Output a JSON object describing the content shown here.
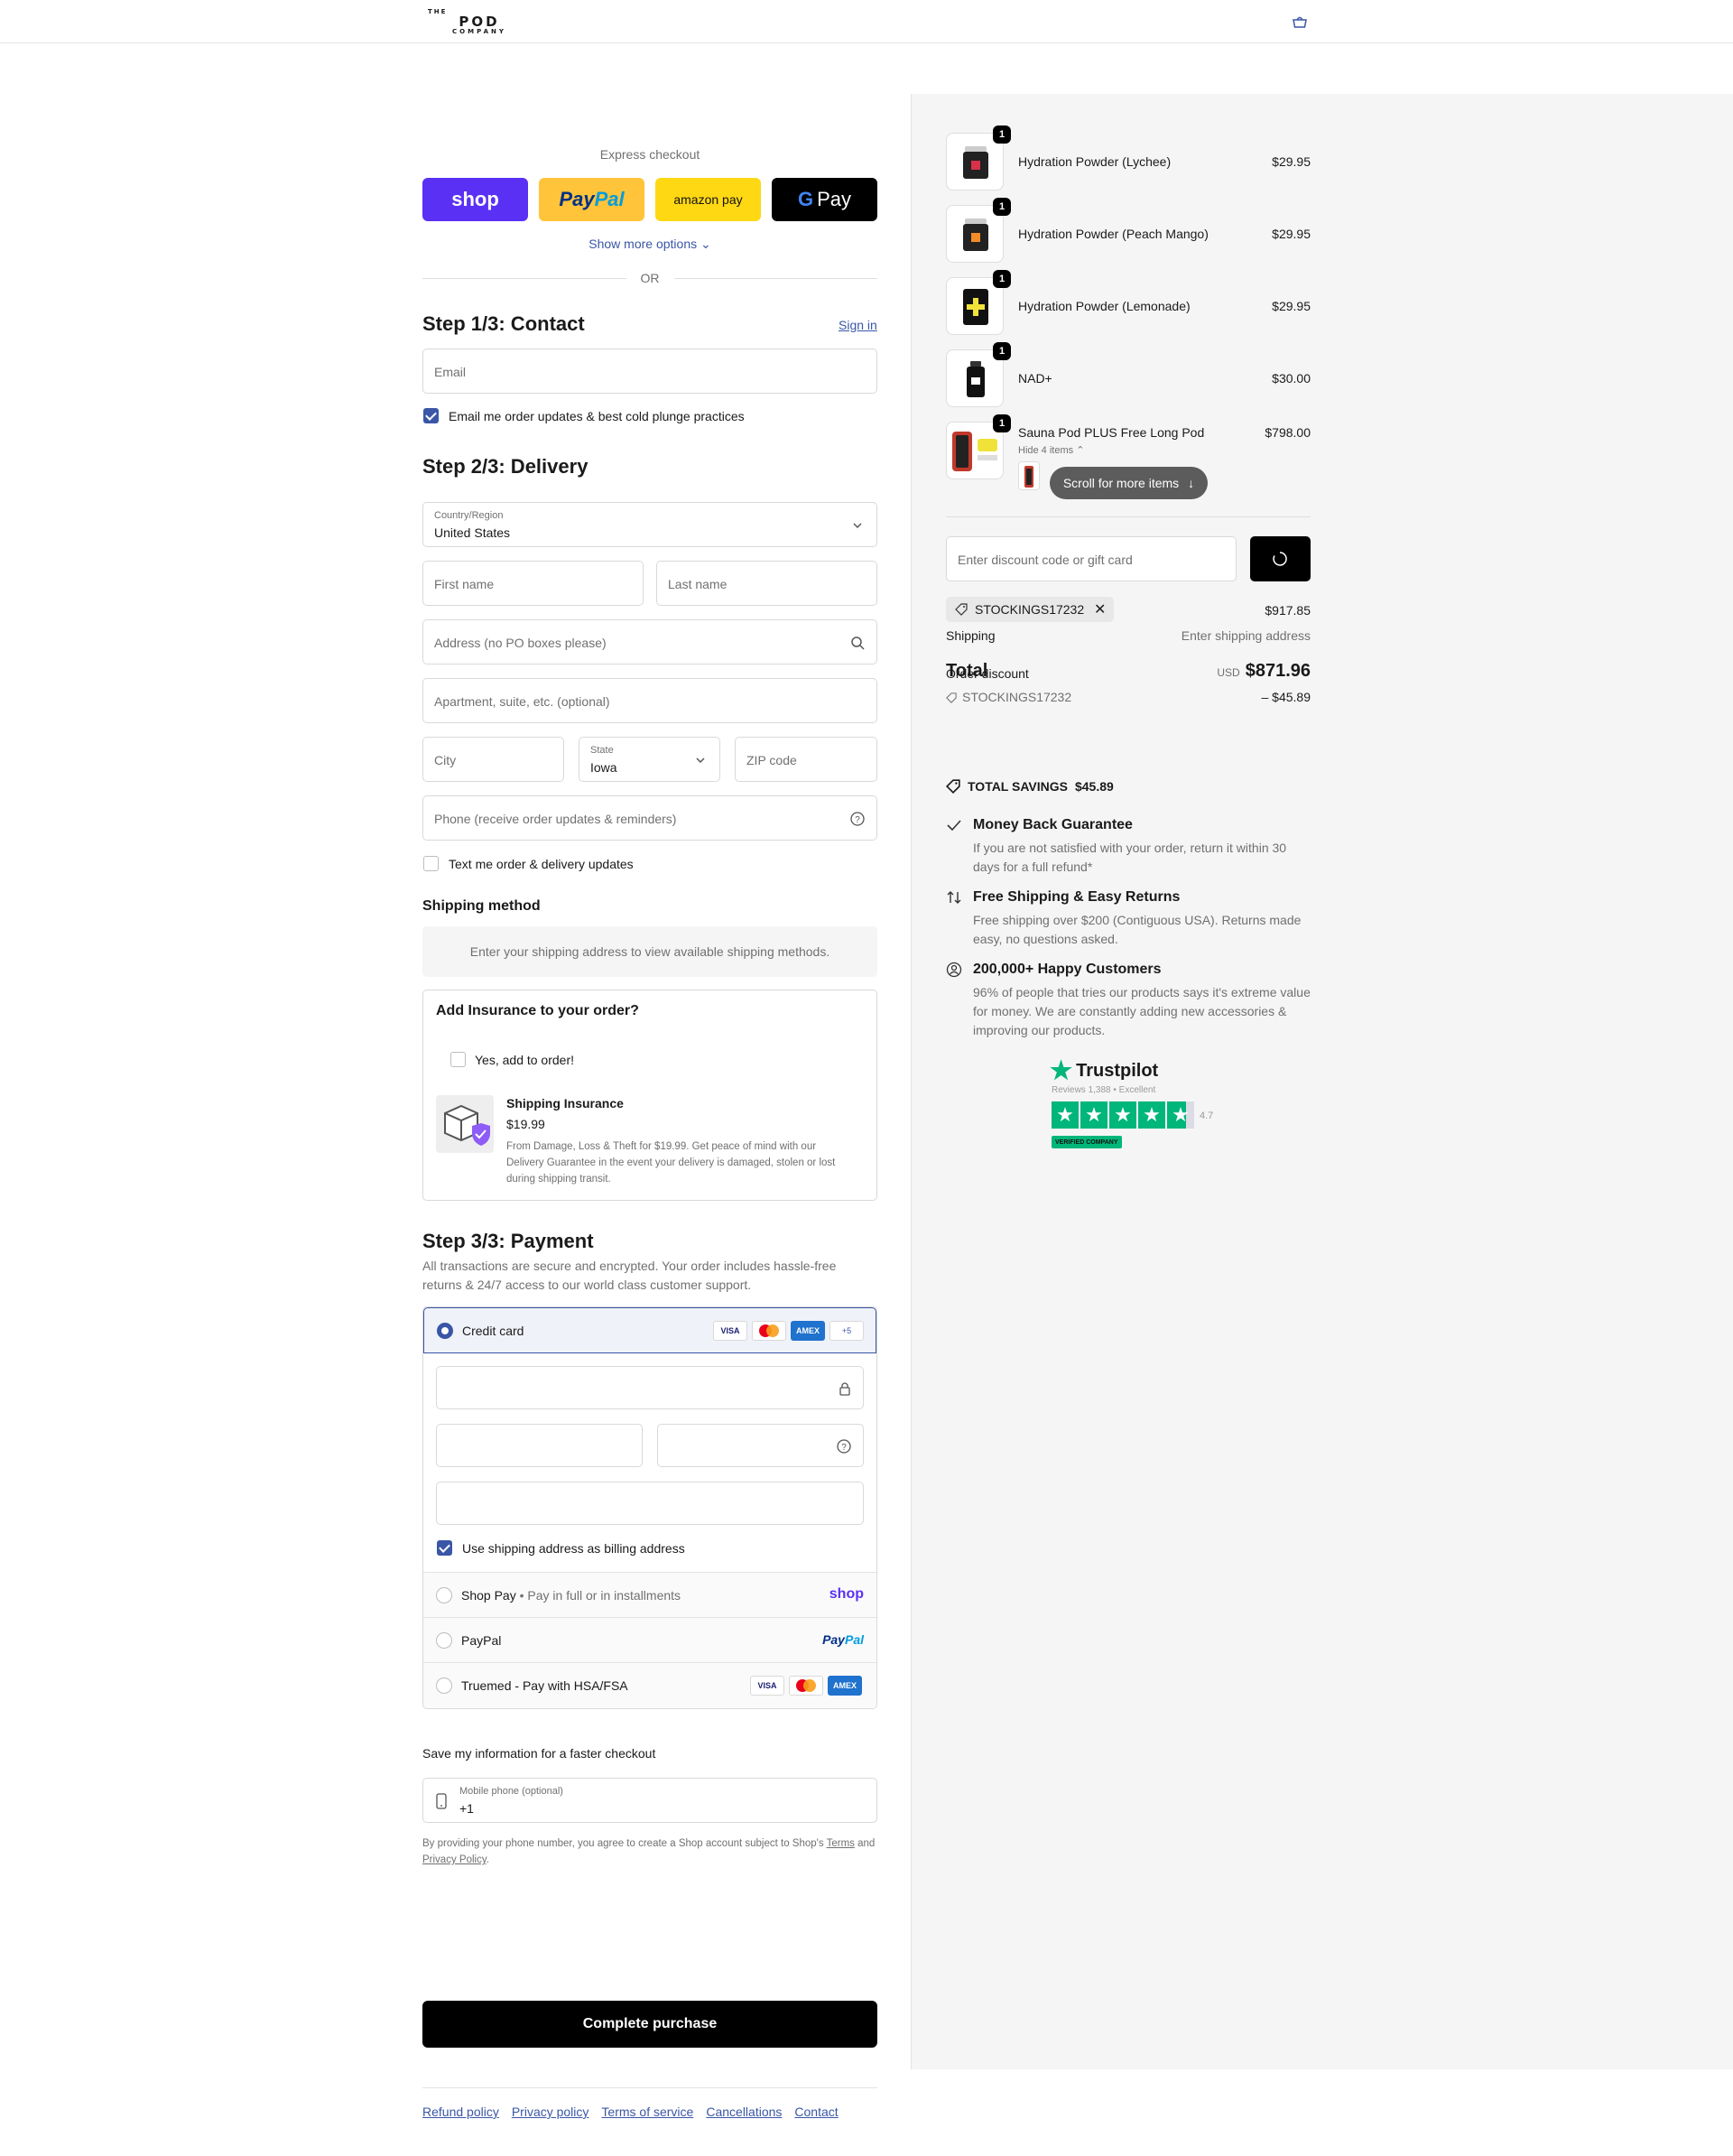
{
  "header": {
    "logo": {
      "line1": "THE",
      "line2": "POD",
      "line3": "COMPANY"
    },
    "cart_icon": "bag-icon"
  },
  "express": {
    "title": "Express checkout",
    "buttons": [
      {
        "label": "shop"
      },
      {
        "label_a": "Pay",
        "label_b": "Pal"
      },
      {
        "label": "amazon pay"
      },
      {
        "label_g": "G",
        "label": "Pay"
      }
    ],
    "show_more": "Show more options",
    "or": "OR"
  },
  "contact": {
    "title": "Step 1/3: Contact",
    "sign_in": "Sign in",
    "email_placeholder": "Email",
    "email_updates": "Email me order updates & best cold plunge practices",
    "email_updates_checked": true
  },
  "delivery": {
    "title": "Step 2/3: Delivery",
    "country_label": "Country/Region",
    "country_value": "United States",
    "first_name": "First name",
    "last_name": "Last name",
    "address": "Address (no PO boxes please)",
    "apartment": "Apartment, suite, etc. (optional)",
    "city": "City",
    "state_label": "State",
    "state_value": "Iowa",
    "zip": "ZIP code",
    "phone": "Phone (receive order updates & reminders)",
    "text_me": "Text me order & delivery updates",
    "text_me_checked": false
  },
  "shipping_method": {
    "title": "Shipping method",
    "message": "Enter your shipping address to view available shipping methods."
  },
  "insurance": {
    "title": "Add Insurance to your order?",
    "yes_label": "Yes, add to order!",
    "name": "Shipping Insurance",
    "price": "$19.99",
    "description": "From Damage, Loss & Theft for $19.99. Get peace of mind with our Delivery Guarantee in the event your delivery is damaged, stolen or lost during shipping transit."
  },
  "payment": {
    "title": "Step 3/3: Payment",
    "description": "All transactions are secure and encrypted. Your order includes hassle-free returns & 24/7 access to our world class customer support.",
    "credit_card": "Credit card",
    "card_badges": [
      "VISA",
      "MC",
      "AMEX",
      "+5"
    ],
    "billing_same": "Use shipping address as billing address",
    "billing_same_checked": true,
    "shop_pay": "Shop Pay",
    "shop_pay_sub": "Pay in full or in installments",
    "shop_pay_logo": "shop",
    "paypal": "PayPal",
    "paypal_logo_a": "Pay",
    "paypal_logo_b": "Pal",
    "truemed": "Truemed - Pay with HSA/FSA",
    "truemed_badges": [
      "VISA",
      "MC",
      "AMEX"
    ]
  },
  "save_info": {
    "title": "Save my information for a faster checkout",
    "phone_label": "Mobile phone (optional)",
    "phone_value": "+1",
    "tos_prefix": "By providing your phone number, you agree to create a Shop account subject to Shop's ",
    "tos_terms": "Terms",
    "tos_and": " and ",
    "tos_privacy": "Privacy Policy",
    "tos_end": "."
  },
  "complete_button": "Complete purchase",
  "footer": {
    "links": [
      "Refund policy",
      "Privacy policy",
      "Terms of service",
      "Cancellations",
      "Contact"
    ]
  },
  "summary": {
    "items": [
      {
        "name": "Hydration Powder (Lychee)",
        "price": "$29.95",
        "qty": "1",
        "accent": "#d8314a"
      },
      {
        "name": "Hydration Powder (Peach Mango)",
        "price": "$29.95",
        "qty": "1",
        "accent": "#f28c28"
      },
      {
        "name": "Hydration Powder (Lemonade)",
        "price": "$29.95",
        "qty": "1",
        "accent": "#f1e23a"
      },
      {
        "name": "NAD+",
        "price": "$30.00",
        "qty": "1",
        "accent": "#ffffff"
      },
      {
        "name": "Sauna Pod PLUS Free Long Pod",
        "price": "$798.00",
        "qty": "1",
        "accent": "#c0392b"
      }
    ],
    "hide_items": "Hide 4 items",
    "scroll_pill": "Scroll for more items",
    "discount_placeholder": "Enter discount code or gift card",
    "discount_code": "STOCKINGS17232",
    "subtotal_value": "$917.85",
    "shipping_label": "Shipping",
    "shipping_value": "Enter shipping address",
    "total_label": "Total",
    "order_discount_label": "Order discount",
    "currency": "USD",
    "total_value": "$871.96",
    "discount_code_line": "STOCKINGS17232",
    "discount_amount": "– $45.89",
    "savings_label": "TOTAL SAVINGS",
    "savings_value": "$45.89"
  },
  "benefits": [
    {
      "icon": "check-icon",
      "title": "Money Back Guarantee",
      "desc": "If you are not satisfied with your order, return it within 30 days for a full refund*"
    },
    {
      "icon": "arrows-swap-icon",
      "title": "Free Shipping & Easy Returns",
      "desc": "Free shipping over $200 (Contiguous USA). Returns made easy, no questions asked."
    },
    {
      "icon": "user-circle-icon",
      "title": "200,000+ Happy Customers",
      "desc": "96% of people that tries our products says it's extreme value for money. We are constantly adding new accessories & improving our products."
    }
  ],
  "trustpilot": {
    "name": "Trustpilot",
    "reviews": "Reviews 1,388 • Excellent",
    "score": "4.7",
    "verified": "VERIFIED COMPANY"
  },
  "colors": {
    "accent": "#3a56a6",
    "shop_purple": "#5a31f4",
    "trustpilot_green": "#00b67a"
  }
}
